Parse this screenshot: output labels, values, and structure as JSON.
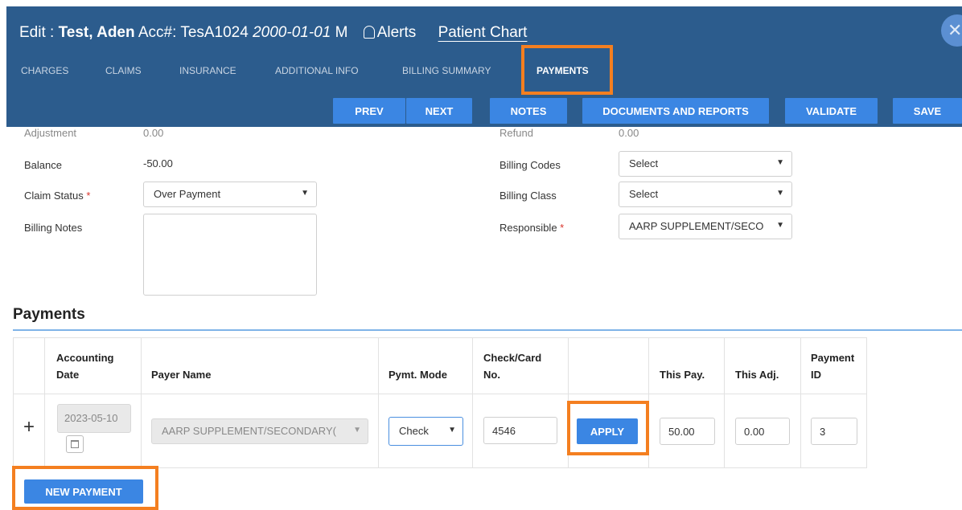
{
  "header": {
    "prefix": "Edit :",
    "patient_name": "Test, Aden",
    "acct_label": "Acc#:",
    "acct_number": "TesA1024",
    "dob": "2000-01-01",
    "sex": "M",
    "alerts_label": "Alerts",
    "chart_link": "Patient Chart",
    "close_glyph": "✕"
  },
  "tabs": [
    {
      "label": "CHARGES"
    },
    {
      "label": "CLAIMS"
    },
    {
      "label": "INSURANCE"
    },
    {
      "label": "ADDITIONAL INFO"
    },
    {
      "label": "BILLING SUMMARY"
    },
    {
      "label": "PAYMENTS",
      "active": true
    }
  ],
  "toolbar": {
    "prev": "PREV",
    "next": "NEXT",
    "notes": "NOTES",
    "documents": "DOCUMENTS AND REPORTS",
    "validate": "VALIDATE",
    "save": "SAVE"
  },
  "form": {
    "adjustment_label": "Adjustment",
    "adjustment_value": "0.00",
    "refund_label": "Refund",
    "refund_value": "0.00",
    "balance_label": "Balance",
    "balance_value": "-50.00",
    "claim_status_label": "Claim Status",
    "claim_status_value": "Over Payment",
    "billing_notes_label": "Billing Notes",
    "billing_codes_label": "Billing Codes",
    "billing_codes_value": "Select",
    "billing_class_label": "Billing Class",
    "billing_class_value": "Select",
    "responsible_label": "Responsible",
    "responsible_value": "AARP SUPPLEMENT/SECO",
    "required_mark": "*",
    "chevron": "⌄"
  },
  "payments": {
    "section_title": "Payments",
    "columns": {
      "accounting_date_1": "Accounting",
      "accounting_date_2": "Date",
      "payer_name": "Payer Name",
      "pymt_mode": "Pymt. Mode",
      "check_card_1": "Check/Card",
      "check_card_2": "No.",
      "this_pay": "This Pay.",
      "this_adj": "This Adj.",
      "payment_id_1": "Payment",
      "payment_id_2": "ID"
    },
    "row": {
      "expand": "+",
      "accounting_date": "2023-05-10",
      "payer_name": "AARP SUPPLEMENT/SECONDARY(",
      "pymt_mode": "Check",
      "check_no": "4546",
      "apply_label": "APPLY",
      "this_pay": "50.00",
      "this_adj": "0.00",
      "payment_id": "3"
    },
    "new_payment_label": "NEW PAYMENT"
  },
  "colors": {
    "header_bg": "#2c5c8d",
    "button_blue": "#3b86e3",
    "highlight": "#f47f20"
  }
}
